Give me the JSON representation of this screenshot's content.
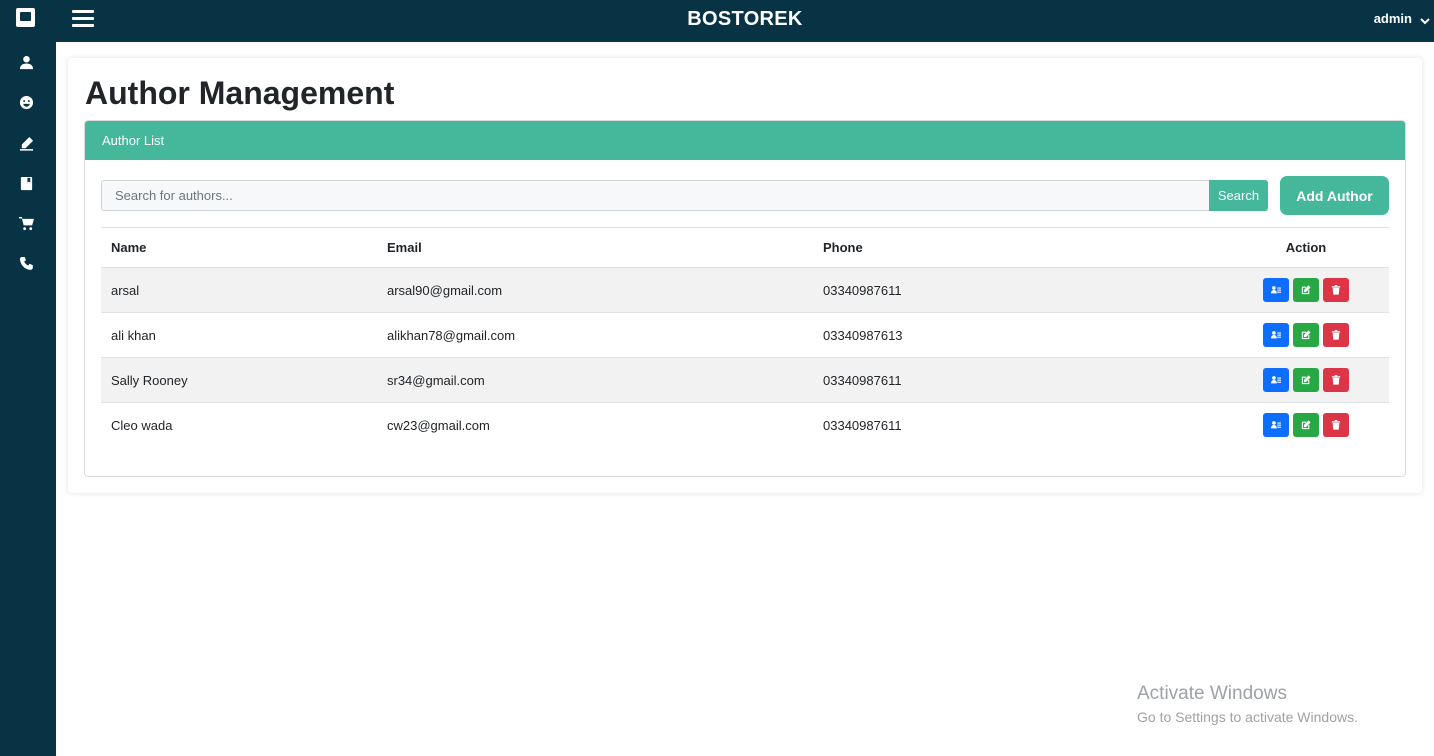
{
  "app": {
    "brand": "BOSTOREK",
    "user": "admin"
  },
  "sidebar": {
    "icons": [
      "user-icon",
      "smile-icon",
      "pen-icon",
      "book-icon",
      "cart-icon",
      "phone-icon"
    ]
  },
  "page": {
    "title": "Author Management"
  },
  "panel": {
    "header": "Author List",
    "search_placeholder": "Search for authors...",
    "search_button": "Search",
    "add_button": "Add Author"
  },
  "table": {
    "columns": {
      "name": "Name",
      "email": "Email",
      "phone": "Phone",
      "action": "Action"
    },
    "rows": [
      {
        "name": "arsal",
        "email": "arsal90@gmail.com",
        "phone": "03340987611"
      },
      {
        "name": "ali khan",
        "email": "alikhan78@gmail.com",
        "phone": "03340987613"
      },
      {
        "name": "Sally Rooney",
        "email": "sr34@gmail.com",
        "phone": "03340987611"
      },
      {
        "name": "Cleo wada",
        "email": "cw23@gmail.com",
        "phone": "03340987611"
      }
    ]
  },
  "watermark": {
    "title": "Activate Windows",
    "subtitle": "Go to Settings to activate Windows."
  },
  "colors": {
    "navy": "#073345",
    "accent": "#45b89c",
    "view": "#0d6efd",
    "edit": "#28a745",
    "delete": "#dc3545"
  }
}
